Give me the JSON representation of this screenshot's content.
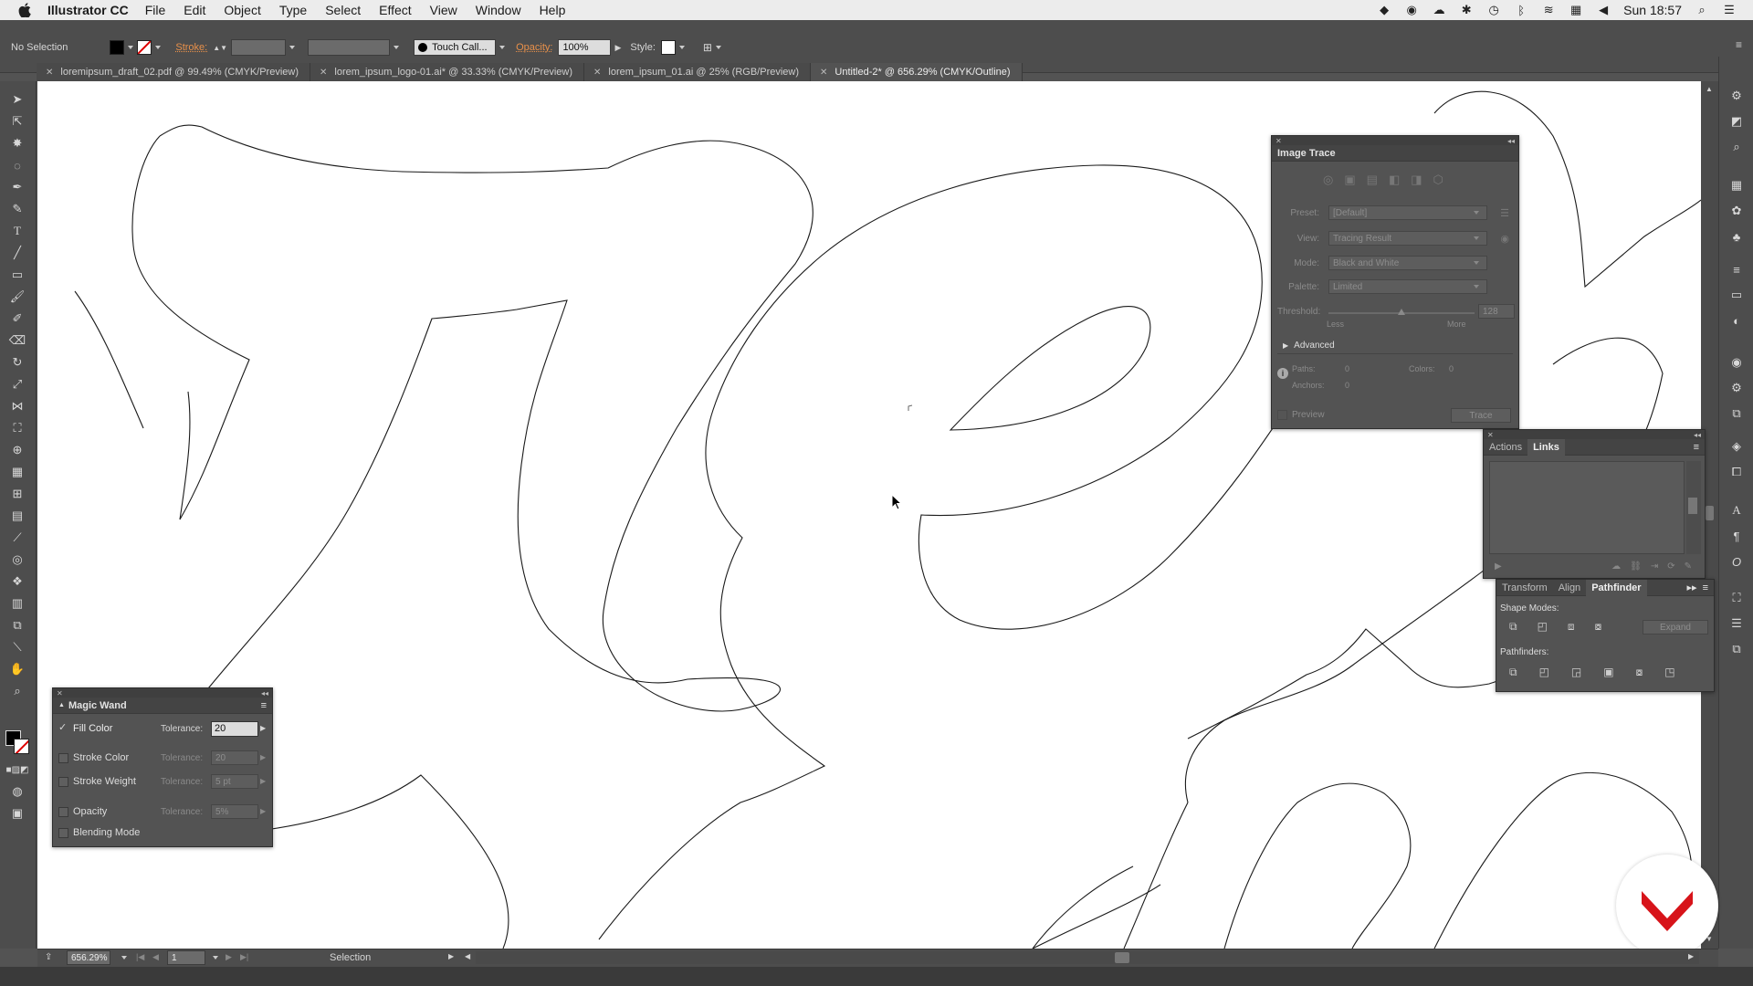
{
  "menubar": {
    "app_name": "Illustrator CC",
    "items": [
      "File",
      "Edit",
      "Object",
      "Type",
      "Select",
      "Effect",
      "View",
      "Window",
      "Help"
    ],
    "clock": "Sun 18:57"
  },
  "control_bar": {
    "selection_label": "No Selection",
    "stroke_label": "Stroke:",
    "brush_label": "Touch Call...",
    "opacity_label": "Opacity:",
    "opacity_value": "100%",
    "style_label": "Style:"
  },
  "tabs": [
    {
      "label": "loremipsum_draft_02.pdf @ 99.49% (CMYK/Preview)",
      "active": false
    },
    {
      "label": "lorem_ipsum_logo-01.ai* @ 33.33% (CMYK/Preview)",
      "active": false
    },
    {
      "label": "lorem_ipsum_01.ai @ 25% (RGB/Preview)",
      "active": false
    },
    {
      "label": "Untitled-2* @ 656.29% (CMYK/Outline)",
      "active": true
    }
  ],
  "image_trace": {
    "title": "Image Trace",
    "preset_label": "Preset:",
    "preset_value": "[Default]",
    "view_label": "View:",
    "view_value": "Tracing Result",
    "mode_label": "Mode:",
    "mode_value": "Black and White",
    "palette_label": "Palette:",
    "palette_value": "Limited",
    "threshold_label": "Threshold:",
    "threshold_value": "128",
    "less_label": "Less",
    "more_label": "More",
    "advanced_label": "Advanced",
    "paths_label": "Paths:",
    "paths_value": "0",
    "colors_label": "Colors:",
    "colors_value": "0",
    "anchors_label": "Anchors:",
    "anchors_value": "0",
    "preview_label": "Preview",
    "trace_button": "Trace"
  },
  "actions_panel": {
    "tab_actions": "Actions",
    "tab_links": "Links"
  },
  "pathfinder_panel": {
    "tab_transform": "Transform",
    "tab_align": "Align",
    "tab_pathfinder": "Pathfinder",
    "shape_modes_label": "Shape Modes:",
    "expand_button": "Expand",
    "pathfinders_label": "Pathfinders:"
  },
  "magic_wand": {
    "title": "Magic Wand",
    "fill_color_label": "Fill Color",
    "fill_color_checked": true,
    "tolerance_label": "Tolerance:",
    "fill_tolerance": "20",
    "stroke_color_label": "Stroke Color",
    "stroke_tolerance": "20",
    "stroke_weight_label": "Stroke Weight",
    "stroke_weight_tolerance": "5 pt",
    "opacity_label": "Opacity",
    "opacity_tolerance": "5%",
    "blending_label": "Blending Mode"
  },
  "status_bar": {
    "zoom": "656.29%",
    "artboard": "1",
    "tool_name": "Selection"
  },
  "colors": {
    "accent_orange": "#e8904a",
    "logo_red": "#d7141a"
  }
}
